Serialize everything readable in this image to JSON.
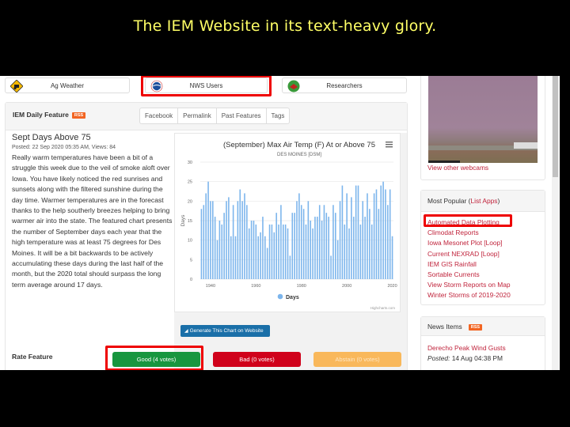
{
  "slide_title": "The IEM Website in its text-heavy glory.",
  "nav": {
    "ag_weather": "Ag Weather",
    "nws_users": "NWS Users",
    "researchers": "Researchers"
  },
  "feature": {
    "header": "IEM Daily Feature",
    "rss_badge": "RSS",
    "tabs": [
      "Facebook",
      "Permalink",
      "Past Features",
      "Tags"
    ],
    "title": "Sept Days Above 75",
    "meta": "Posted: 22 Sep 2020 05:35 AM, Views: 84",
    "body": "Really warm temperatures have been a bit of a struggle this week due to the veil of smoke aloft over Iowa. You have likely noticed the red sunrises and sunsets along with the filtered sunshine during the day time. Warmer temperatures are in the forecast thanks to the help southerly breezes helping to bring warmer air into the state. The featured chart presents the number of September days each year that the high temperature was at least 75 degrees for Des Moines. It will be a bit backwards to be actively accumulating these days during the last half of the month, but the 2020 total should surpass the long term average around 17 days.",
    "generate_button": "Generate This Chart on Website",
    "rate_label": "Rate Feature",
    "vote_good": "Good (4 votes)",
    "vote_bad": "Bad (0 votes)",
    "vote_abstain": "Abstain (0 votes)"
  },
  "chart_data": {
    "type": "bar",
    "title": "(September) Max Air Temp (F) At or Above 75",
    "subtitle": "DES MOINES [DSM]",
    "xlabel": "",
    "ylabel": "Days",
    "ylim": [
      0,
      30
    ],
    "yticks": [
      0,
      5,
      10,
      15,
      20,
      25,
      30
    ],
    "xticks": [
      1940,
      1960,
      1980,
      2000,
      2020
    ],
    "xlim": [
      1936,
      2020
    ],
    "legend": [
      "Days"
    ],
    "legend_position": "bottom",
    "credits": "Highcharts.com",
    "series_color": "#7cb5ec",
    "x_start": 1936,
    "values": [
      18,
      19,
      22,
      25,
      20,
      20,
      16,
      10,
      15,
      14,
      17,
      20,
      21,
      11,
      19,
      11,
      20,
      23,
      20,
      22,
      19,
      13,
      15,
      15,
      14,
      11,
      12,
      16,
      11,
      8,
      14,
      14,
      12,
      17,
      14,
      19,
      14,
      14,
      13,
      6,
      17,
      17,
      20,
      22,
      19,
      18,
      14,
      20,
      15,
      13,
      16,
      16,
      19,
      15,
      19,
      17,
      16,
      6,
      19,
      17,
      10,
      20,
      24,
      14,
      22,
      13,
      21,
      16,
      24,
      24,
      14,
      20,
      16,
      22,
      18,
      14,
      22,
      23,
      18,
      24,
      25,
      23,
      19,
      23,
      11
    ]
  },
  "sidebar": {
    "webcam_link": "View other webcams",
    "most_popular_label": "Most Popular (",
    "list_apps": "List Apps",
    "most_popular_close": ")",
    "popular_links": [
      "Automated Data Plotting",
      "Climodat Reports",
      "Iowa Mesonet Plot [Loop]",
      "Current NEXRAD [Loop]",
      "IEM GIS Rainfall",
      "Sortable Currents",
      "View Storm Reports on Map",
      "Winter Storms of 2019-2020"
    ],
    "news_header": "News Items",
    "rss_badge": "RSS",
    "news_title": "Derecho Peak Wind Gusts",
    "news_posted_label": "Posted:",
    "news_posted_value": " 14 Aug 04:38 PM"
  }
}
